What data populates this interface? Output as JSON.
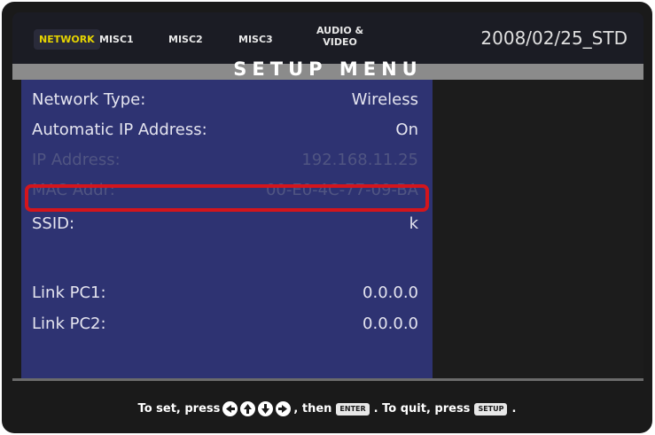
{
  "tabs": [
    {
      "label": "NETWORK",
      "active": true
    },
    {
      "label": "MISC1",
      "active": false
    },
    {
      "label": "MISC2",
      "active": false
    },
    {
      "label": "MISC3",
      "active": false
    },
    {
      "label_line1": "AUDIO &",
      "label_line2": "VIDEO",
      "active": false
    }
  ],
  "datetime": "2008/02/25_STD",
  "menu_title": "SETUP MENU",
  "rows": [
    {
      "label": "Network Type:",
      "value": "Wireless",
      "enabled": true
    },
    {
      "label": "Automatic IP Address:",
      "value": "On",
      "enabled": true
    },
    {
      "label": "IP Address:",
      "value": "192.168.11.25",
      "enabled": false
    },
    {
      "label": "MAC Addr:",
      "value": "00-E0-4C-77-09-BA",
      "enabled": false,
      "highlighted": true
    },
    {
      "label": "SSID:",
      "value": "k",
      "enabled": true
    },
    {
      "label": "Link PC1:",
      "value": "0.0.0.0",
      "enabled": true
    },
    {
      "label": "Link PC2:",
      "value": "0.0.0.0",
      "enabled": true
    }
  ],
  "footer": {
    "prefix": "To set, press",
    "then": ", then",
    "enter_key": "ENTER",
    "quit": ". To quit, press",
    "setup_key": "SETUP",
    "suffix": "."
  },
  "colors": {
    "active_tab": "#e6d400",
    "menu_panel": "#2e3372",
    "highlight_border": "#d4151c"
  },
  "icons": [
    "left-arrow-button-icon",
    "up-arrow-button-icon",
    "down-arrow-button-icon",
    "right-arrow-button-icon"
  ]
}
